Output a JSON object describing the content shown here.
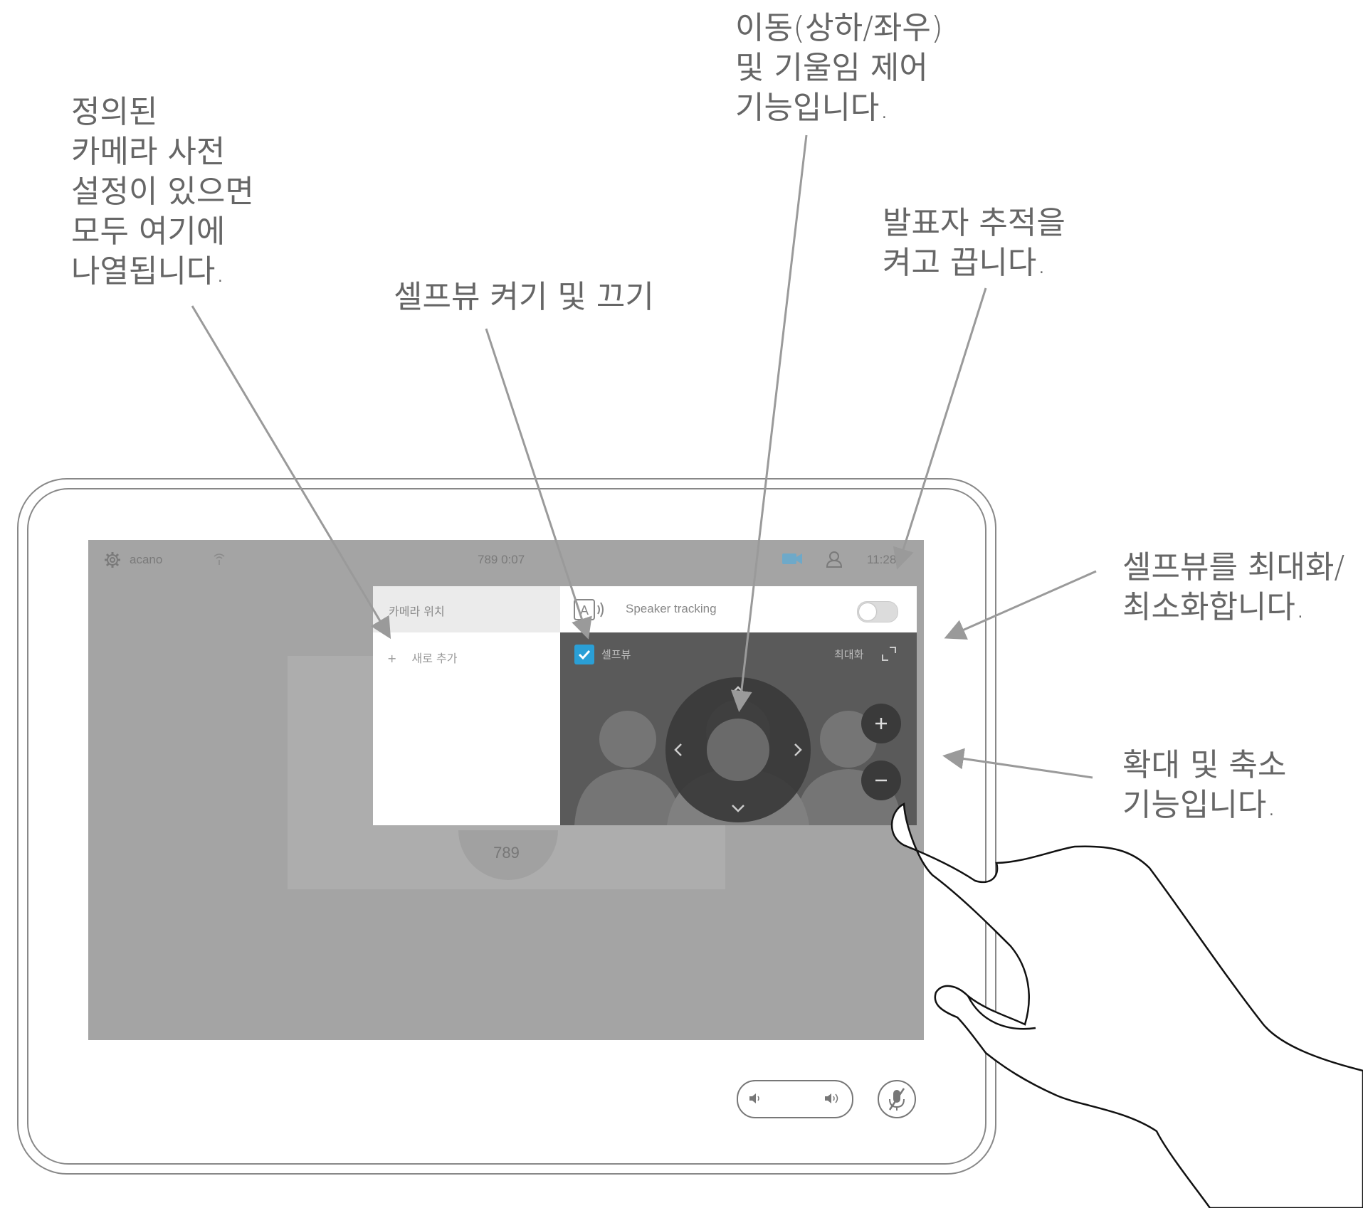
{
  "callouts": {
    "presets": [
      "정의된",
      "카메라 사전",
      "설정이 있으면",
      "모두 여기에",
      "나열됩니다."
    ],
    "selfview_toggle": [
      "셀프뷰 켜기 및 끄기"
    ],
    "pan_tilt": [
      "이동(상하/좌우)",
      "및 기울임 제어",
      "기능입니다."
    ],
    "speaker_track": [
      "발표자 추적을",
      "켜고 끕니다."
    ],
    "maximize": [
      "셀프뷰를 최대화/",
      "최소화합니다."
    ],
    "zoom": [
      "확대 및 축소",
      "기능입니다."
    ]
  },
  "statusbar": {
    "system_name": "acano",
    "call_info": "789 0:07",
    "time": "11:28"
  },
  "call_tile": {
    "number": "789"
  },
  "camera_panel": {
    "presets_header": "카메라 위치",
    "add_new": "새로 추가",
    "speaker_tracking_label": "Speaker tracking",
    "speaker_tracking_on": false,
    "selfview_label": "셀프뷰",
    "selfview_checked": true,
    "maximize_label": "최대화"
  },
  "colors": {
    "accent": "#2a9fd6",
    "screen_bg": "#a4a4a4",
    "selfview_bg": "#5a5a5a",
    "callout_text": "#666666"
  },
  "icons": {
    "settings": "gear-icon",
    "video": "camera-icon",
    "participants": "person-icon",
    "volume_down": "speaker-low-icon",
    "volume_up": "speaker-high-icon",
    "mute": "mic-off-icon"
  }
}
